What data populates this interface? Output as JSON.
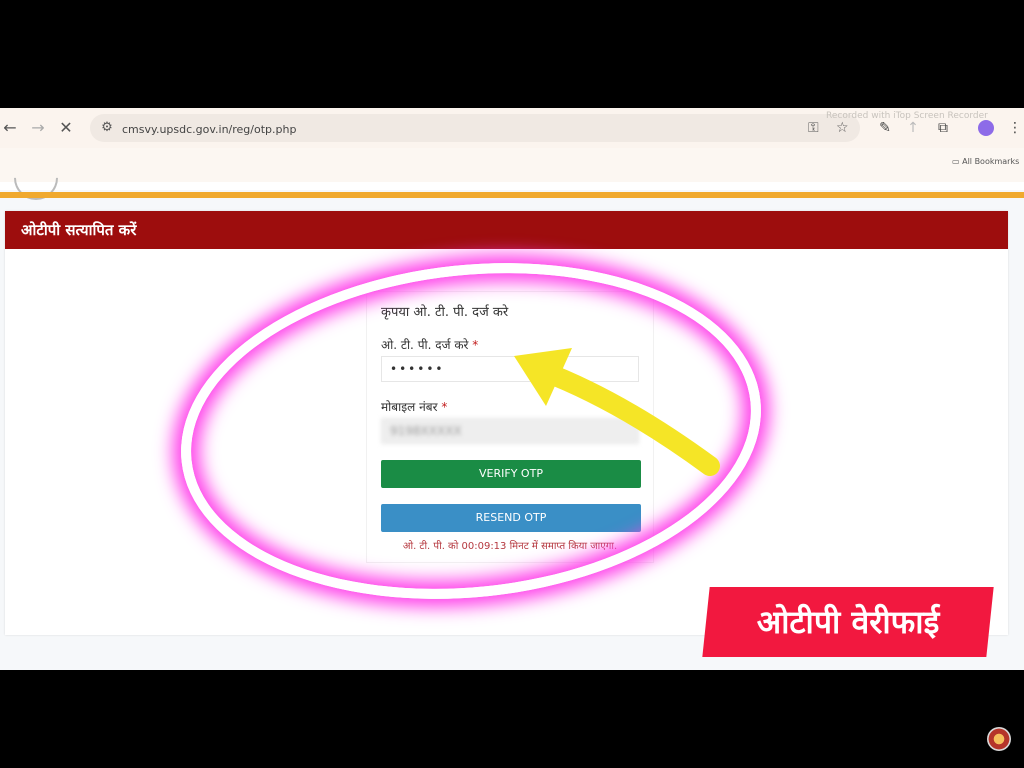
{
  "browser": {
    "url": "cmsvy.upsdc.gov.in/reg/otp.php",
    "bookmarks_label": "All Bookmarks",
    "watermark": "Recorded with iTop Screen Recorder"
  },
  "page": {
    "header_title": "ओटीपी सत्यापित करें",
    "form": {
      "title": "कृपया ओ. टी. पी. दर्ज करे",
      "otp_label": "ओ. टी. पी. दर्ज करे",
      "otp_value": "••••••",
      "mobile_label": "मोबाइल नंबर",
      "mobile_value": "9198XXXXX",
      "verify_label": "VERIFY OTP",
      "resend_label": "RESEND OTP",
      "timer_text": "ओ. टी. पी. को 00:09:13 मिनट में समाप्त किया जाएगा."
    }
  },
  "overlay": {
    "banner_text": "ओटीपी वेरीफाई",
    "colors": {
      "ring_glow": "#ff3dea",
      "arrow": "#f5e526",
      "banner": "#f2183f"
    }
  }
}
